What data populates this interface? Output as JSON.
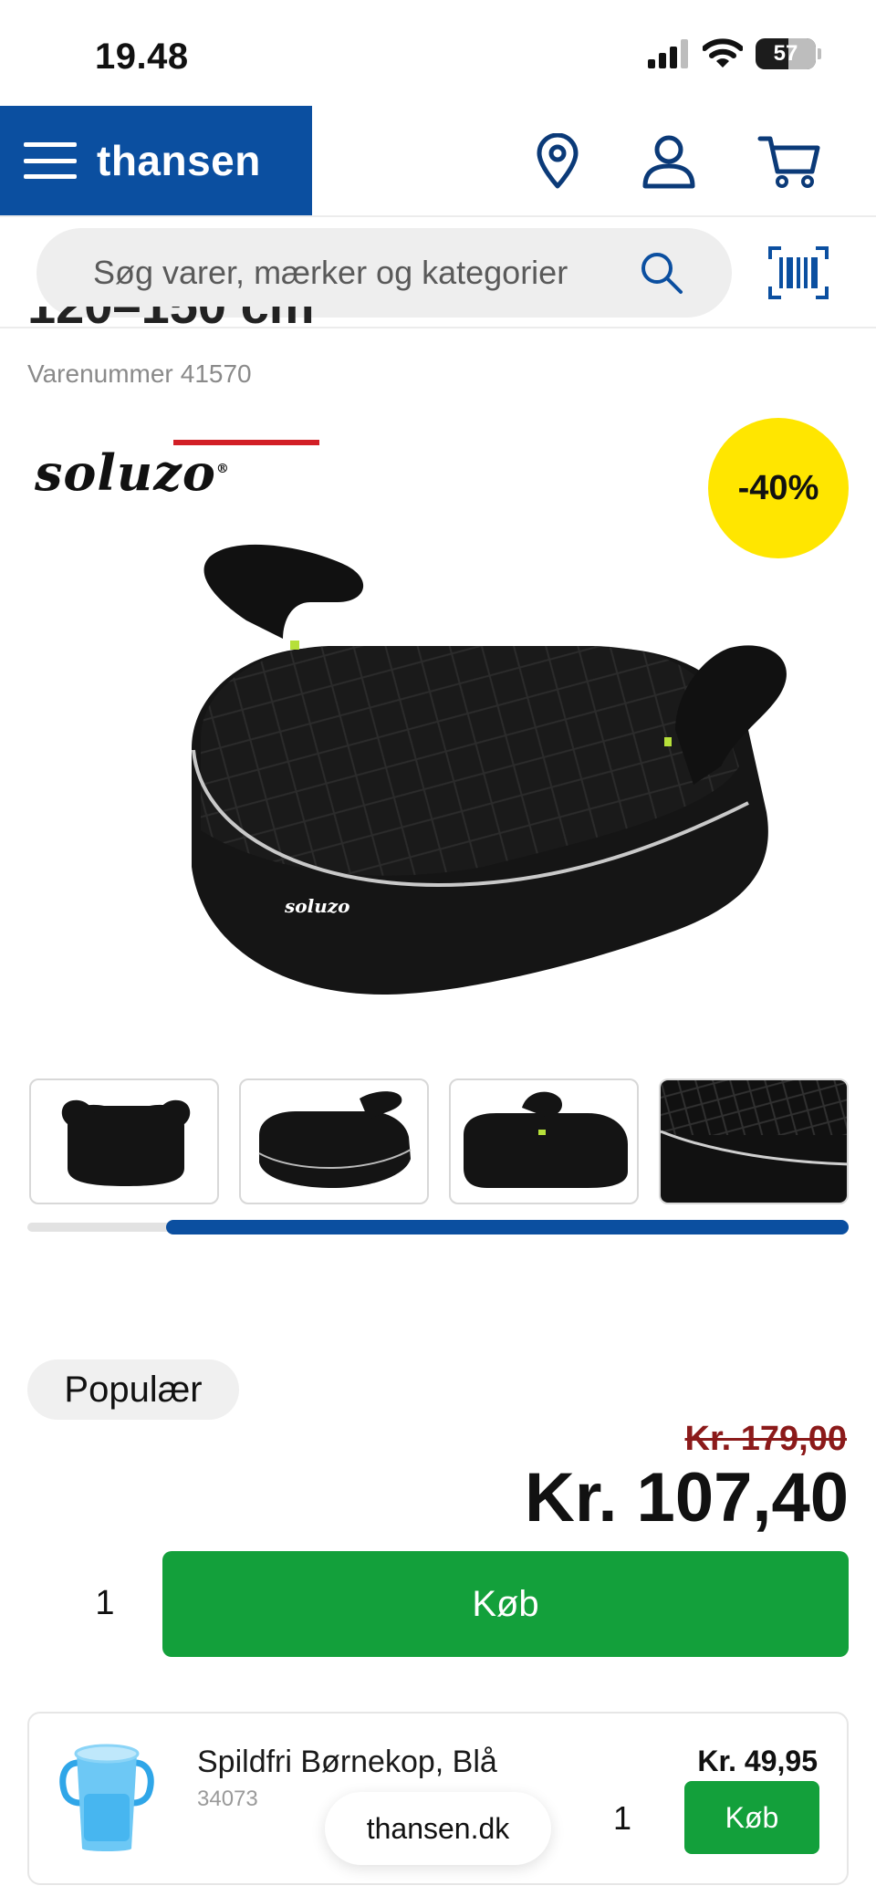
{
  "status_bar": {
    "time": "19.48",
    "battery": "57"
  },
  "header": {
    "brand": "thansen"
  },
  "search": {
    "placeholder": "Søg varer, mærker og kategorier"
  },
  "product": {
    "title_partial": "120–150 cm",
    "sku_label": "Varenummer",
    "sku": "41570",
    "brand_logo": "soluzo",
    "discount_badge": "-40%",
    "popular_label": "Populær",
    "old_price": "Kr. 179,00",
    "price": "Kr. 107,40",
    "quantity": "1",
    "buy_label": "Køb",
    "gallery_progress_fraction": 0.83
  },
  "related": {
    "name": "Spildfri Børnekop, Blå",
    "sku": "34073",
    "price": "Kr. 49,95",
    "quantity": "1",
    "buy_label": "Køb"
  },
  "browser": {
    "url": "thansen.dk"
  },
  "colors": {
    "brand_blue": "#0b4fa0",
    "buy_green": "#13a03b",
    "badge_yellow": "#ffe600",
    "old_price_red": "#8b1a1a"
  }
}
